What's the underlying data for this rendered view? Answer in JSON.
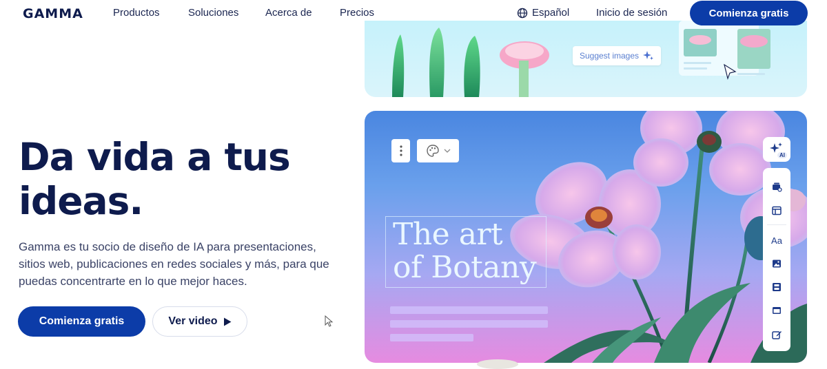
{
  "nav": {
    "logo": "GAMMA",
    "links": [
      "Productos",
      "Soluciones",
      "Acerca de",
      "Precios"
    ],
    "language": "Español",
    "login": "Inicio de sesión",
    "cta": "Comienza gratis"
  },
  "hero": {
    "title_line1": "Da vida a tus",
    "title_line2": "ideas.",
    "subtitle": "Gamma es tu socio de diseño de IA para presentaciones, sitios web, publicaciones en redes sociales y más, para que puedas concentrarte en lo que mejor haces.",
    "primary_button": "Comienza gratis",
    "secondary_button": "Ver video"
  },
  "preview_top": {
    "suggest_label": "Suggest images"
  },
  "preview_main": {
    "art_title_line1": "The art",
    "art_title_line2": "of Botany",
    "ai_badge": "AI",
    "toolbar_text_label": "Aa"
  },
  "colors": {
    "brand": "#0c3ca8",
    "heading": "#0e1b4d"
  }
}
